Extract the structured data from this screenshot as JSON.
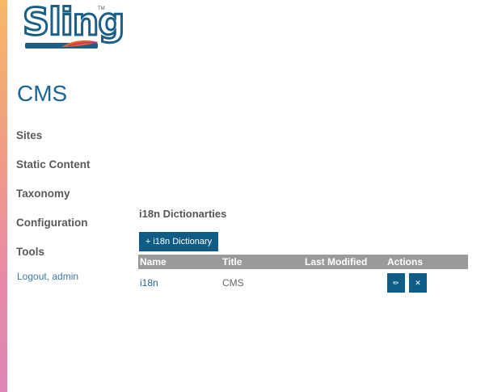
{
  "brand": {
    "logo_text": "Sling",
    "trademark": "TM"
  },
  "app": {
    "title": "CMS"
  },
  "nav": {
    "items": [
      {
        "label": "Sites"
      },
      {
        "label": "Static Content"
      },
      {
        "label": "Taxonomy"
      },
      {
        "label": "Configuration"
      },
      {
        "label": "Tools"
      }
    ],
    "logout_label": "Logout, admin"
  },
  "main": {
    "section_title": "i18n Dictionarties",
    "add_button_label": "+ i18n Dictionary",
    "table": {
      "headers": [
        "Name",
        "Title",
        "Last Modified",
        "Actions"
      ],
      "rows": [
        {
          "name": "i18n",
          "title": "CMS",
          "last_modified": ""
        }
      ],
      "actions": {
        "edit_glyph": "✏",
        "delete_glyph": "✕"
      }
    }
  },
  "colors": {
    "accent": "#0f5c86",
    "title_blue": "#1d6390",
    "header_gray": "#9a9a9a"
  }
}
